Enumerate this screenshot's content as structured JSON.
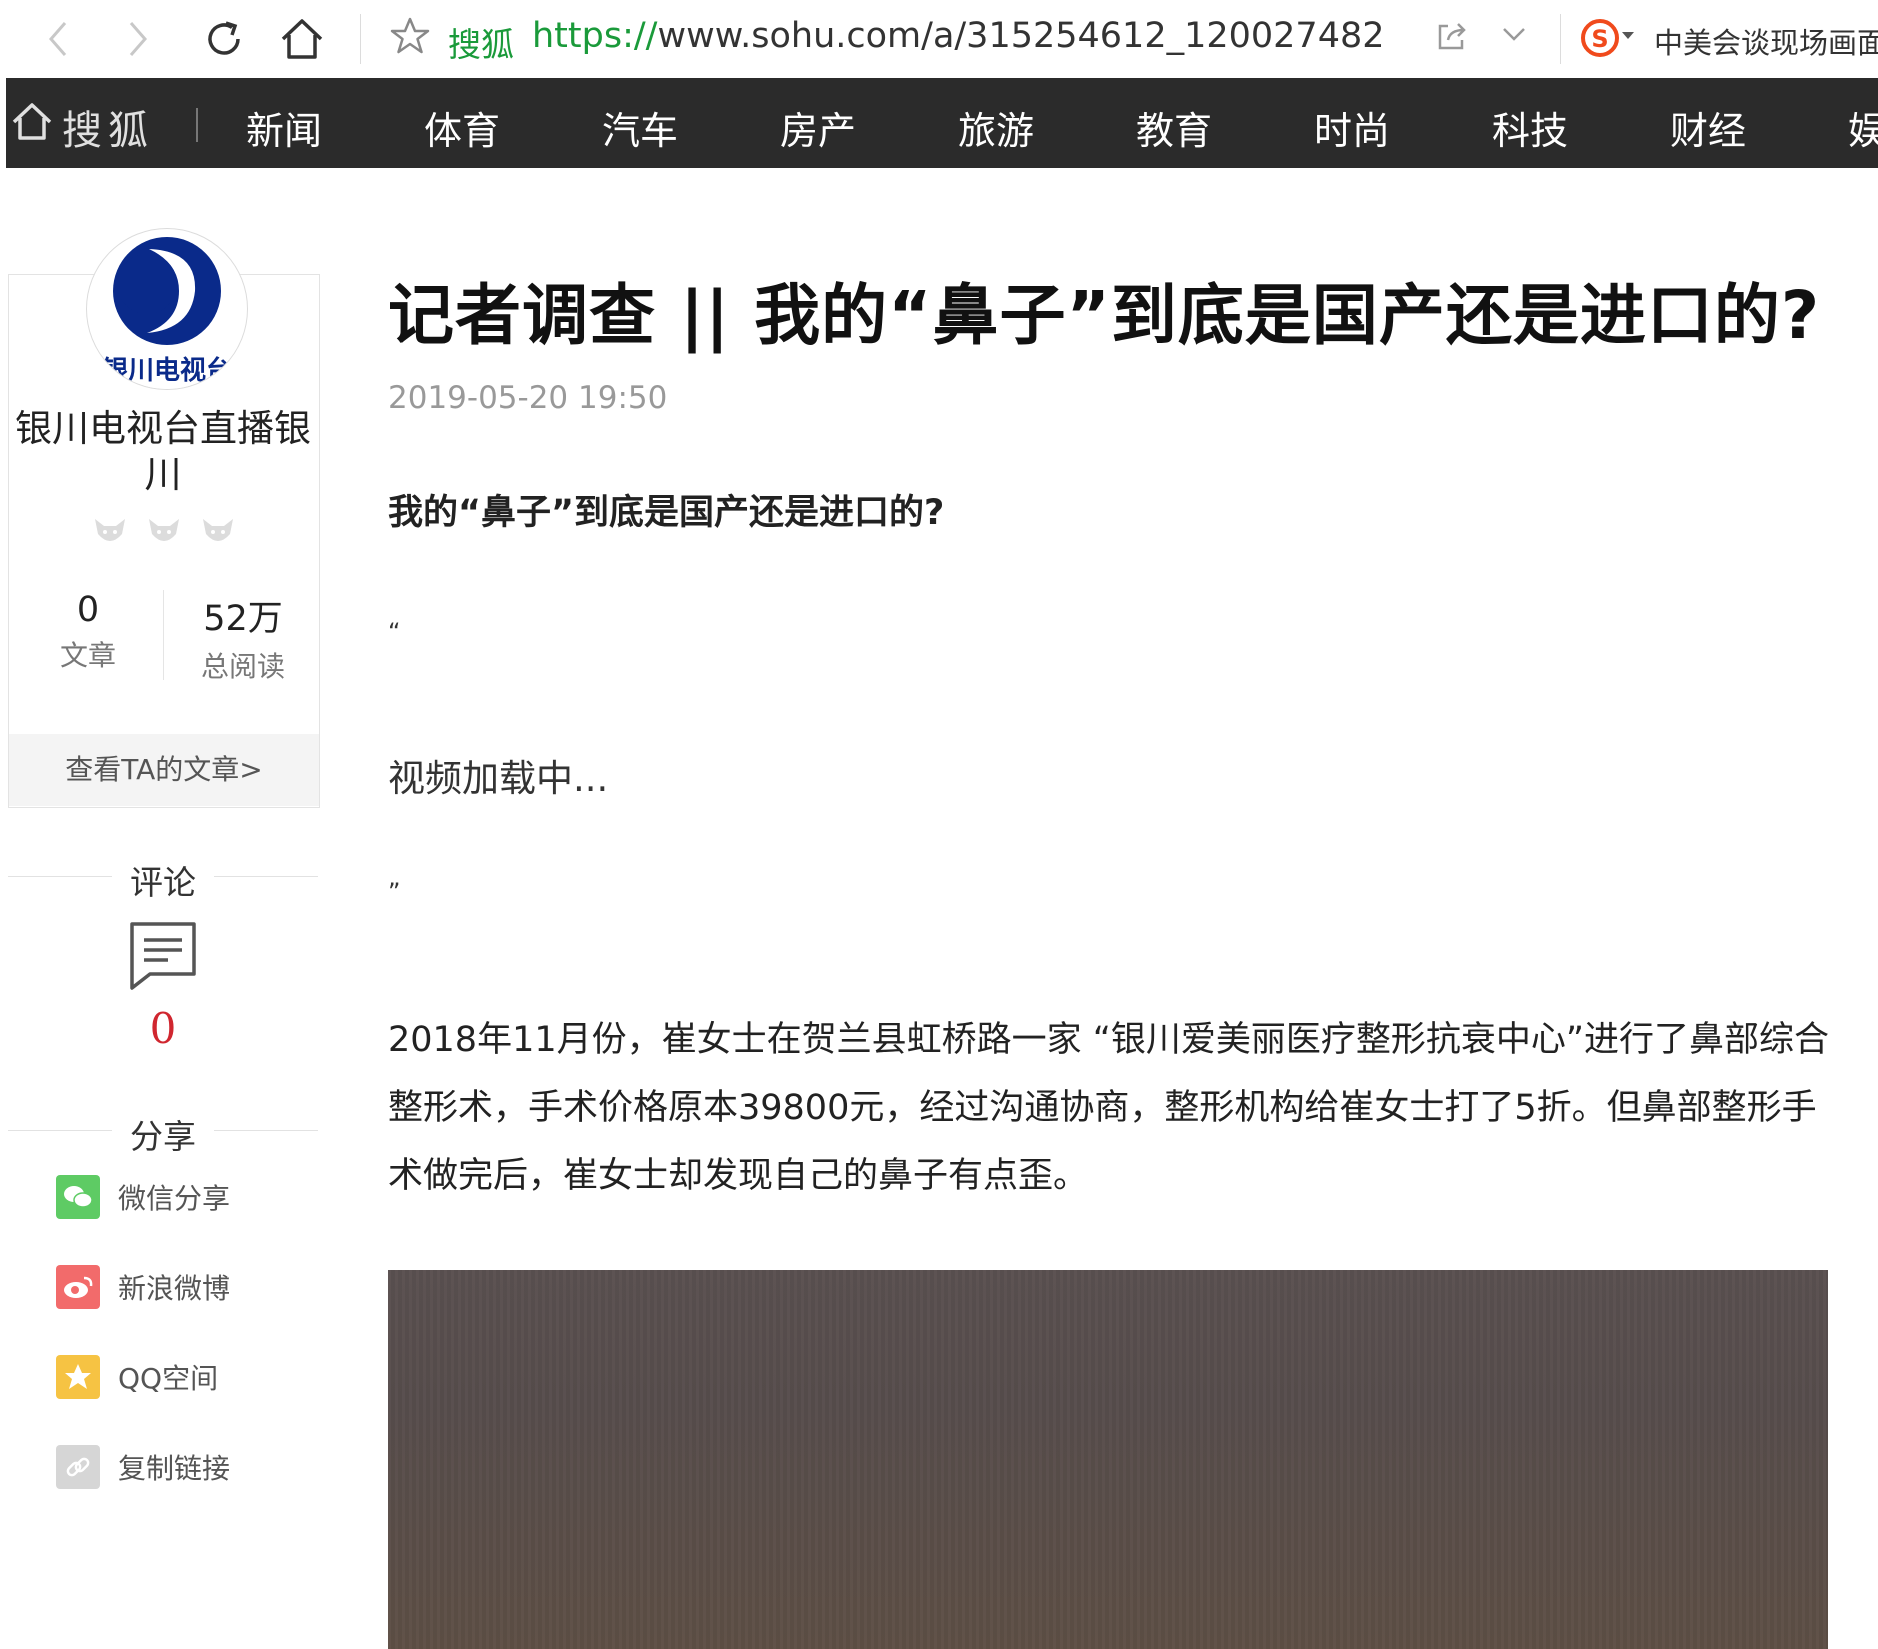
{
  "browser": {
    "site_label": "搜狐",
    "url_protocol": "https://",
    "url_rest": "www.sohu.com/a/315254612_120027482",
    "search_hint": "中美会谈现场画面"
  },
  "nav": {
    "logo": "搜狐",
    "items": [
      "新闻",
      "体育",
      "汽车",
      "房产",
      "旅游",
      "教育",
      "时尚",
      "科技",
      "财经",
      "娱"
    ]
  },
  "author": {
    "name": "银川电视台直播银川",
    "avatar_text": "银川电视台",
    "articles_count": "0",
    "articles_label": "文章",
    "reads_count": "52万",
    "reads_label": "总阅读",
    "view_articles": "查看TA的文章>"
  },
  "comments": {
    "title": "评论",
    "count": "0"
  },
  "share": {
    "title": "分享",
    "items": [
      {
        "label": "微信分享",
        "icon": "wechat-icon",
        "color": "#5ecb64"
      },
      {
        "label": "新浪微博",
        "icon": "weibo-icon",
        "color": "#f26b6b"
      },
      {
        "label": "QQ空间",
        "icon": "qzone-icon",
        "color": "#f6c343"
      },
      {
        "label": "复制链接",
        "icon": "link-icon",
        "color": "#d6d6d6"
      }
    ]
  },
  "article": {
    "title": "记者调查 || 我的“鼻子”到底是国产还是进口的?",
    "time": "2019-05-20 19:50",
    "subtitle": "我的“鼻子”到底是国产还是进口的?",
    "quote_open": "“",
    "video_loading": "视频加载中...",
    "quote_close": "”",
    "paragraph": "2018年11月份，崔女士在贺兰县虹桥路一家 “银川爱美丽医疗整形抗衰中心”进行了鼻部综合整形术，手术价格原本39800元，经过沟通协商，整形机构给崔女士打了5折。但鼻部整形手术做完后，崔女士却发现自己的鼻子有点歪。"
  }
}
